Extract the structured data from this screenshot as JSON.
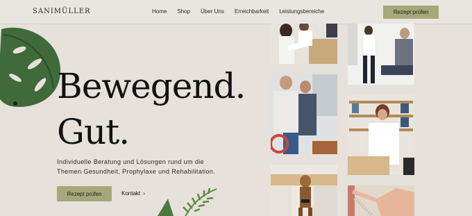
{
  "brand": {
    "logo_text": "SANIMÜLLER"
  },
  "nav": {
    "items": [
      "Home",
      "Shop",
      "Über Uns",
      "Erreichbarkeit",
      "Leistungsbereiche"
    ],
    "cta_label": "Rezept prüfen"
  },
  "hero": {
    "headline_line1": "Bewegend.",
    "headline_line2": "Gut.",
    "description_line1": "Individuelle Beratung und Lösungen rund um die",
    "description_line2": "Themen Gesundheit, Prophylaxe und Rehabilitation.",
    "primary_button": "Rezept prüfen",
    "secondary_link": "Kontakt",
    "secondary_link_arrow": "›"
  },
  "colors": {
    "background": "#e6e1da",
    "accent": "#a5a878",
    "text": "#1d1d1b"
  }
}
